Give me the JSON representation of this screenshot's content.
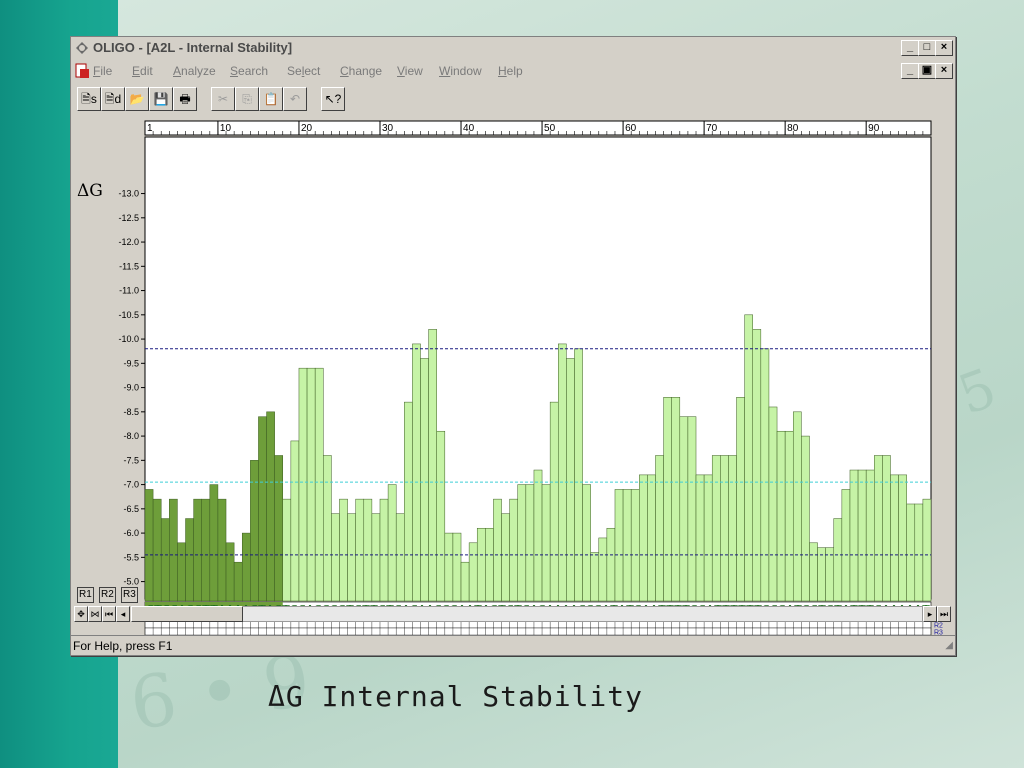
{
  "window": {
    "title": "OLIGO - [A2L - Internal Stability]",
    "controls": {
      "minimize": "_",
      "maximize": "□",
      "close": "×"
    },
    "mdi_controls": {
      "minimize": "_",
      "restore": "▣",
      "close": "×"
    }
  },
  "menu": {
    "items": [
      {
        "key": "F",
        "rest": "ile"
      },
      {
        "key": "E",
        "rest": "dit"
      },
      {
        "key": "A",
        "rest": "nalyze"
      },
      {
        "key": "S",
        "rest": "earch"
      },
      {
        "key": "l",
        "pre": "Se",
        "rest": "ect"
      },
      {
        "key": "C",
        "rest": "hange"
      },
      {
        "key": "V",
        "rest": "iew"
      },
      {
        "key": "W",
        "rest": "indow"
      },
      {
        "key": "H",
        "rest": "elp"
      }
    ]
  },
  "toolbar": {
    "buttons": [
      {
        "icon": "sense-primer-icon",
        "glyph": "🗎s",
        "disabled": false
      },
      {
        "icon": "antisense-primer-icon",
        "glyph": "🗎d",
        "disabled": false
      },
      {
        "icon": "open-folder-icon",
        "glyph": "📂",
        "disabled": false
      },
      {
        "icon": "save-icon",
        "glyph": "💾",
        "disabled": false
      },
      {
        "icon": "print-icon",
        "glyph": "🖶",
        "disabled": false
      },
      {
        "icon": "cut-icon",
        "glyph": "✂",
        "disabled": true
      },
      {
        "icon": "copy-icon",
        "glyph": "⎘",
        "disabled": true
      },
      {
        "icon": "paste-icon",
        "glyph": "📋",
        "disabled": true
      },
      {
        "icon": "undo-icon",
        "glyph": "↶",
        "disabled": true
      },
      {
        "icon": "help-pointer-icon",
        "glyph": "↖?",
        "disabled": false
      }
    ]
  },
  "chart_data": {
    "type": "bar",
    "ylabel": "ΔG",
    "ylim": [
      -4.6,
      -13.3
    ],
    "yticks": [
      "-13.0",
      "-12.5",
      "-12.0",
      "-11.5",
      "-11.0",
      "-10.5",
      "-10.0",
      "-9.5",
      "-9.0",
      "-8.5",
      "-8.0",
      "-7.5",
      "-7.0",
      "-6.5",
      "-6.0",
      "-5.5",
      "-5.0"
    ],
    "xticks": [
      "1",
      "10",
      "20",
      "30",
      "40",
      "50",
      "60",
      "70",
      "80",
      "90"
    ],
    "xtick_positions": [
      1,
      10,
      20,
      30,
      40,
      50,
      60,
      70,
      80,
      90
    ],
    "hlines": [
      {
        "value": -9.8,
        "color": "#1a1a80",
        "style": "dashed"
      },
      {
        "value": -7.05,
        "color": "#3fcfd8",
        "style": "dashed"
      },
      {
        "value": -5.55,
        "color": "#1a1a80",
        "style": "dashed"
      }
    ],
    "highlight_count": 17,
    "colors": {
      "highlight": "#6e9e3a",
      "normal": "#c6f3a6",
      "edge": "#3a5a20"
    },
    "values": [
      -6.9,
      -6.7,
      -6.3,
      -6.7,
      -5.8,
      -6.3,
      -6.7,
      -6.7,
      -7.0,
      -6.7,
      -5.8,
      -5.4,
      -6.0,
      -7.5,
      -8.4,
      -8.5,
      -7.6,
      -6.7,
      -7.9,
      -9.4,
      -9.4,
      -9.4,
      -7.6,
      -6.4,
      -6.7,
      -6.4,
      -6.7,
      -6.7,
      -6.4,
      -6.7,
      -7.0,
      -6.4,
      -8.7,
      -9.9,
      -9.6,
      -10.2,
      -8.1,
      -6.0,
      -6.0,
      -5.4,
      -5.8,
      -6.1,
      -6.1,
      -6.7,
      -6.4,
      -6.7,
      -7.0,
      -7.0,
      -7.3,
      -7.0,
      -8.7,
      -9.9,
      -9.6,
      -9.8,
      -7.0,
      -5.6,
      -5.9,
      -6.1,
      -6.9,
      -6.9,
      -6.9,
      -7.2,
      -7.2,
      -7.6,
      -8.8,
      -8.8,
      -8.4,
      -8.4,
      -7.2,
      -7.2,
      -7.6,
      -7.6,
      -7.6,
      -8.8,
      -10.5,
      -10.2,
      -9.8,
      -8.6,
      -8.1,
      -8.1,
      -8.5,
      -8.0,
      -5.8,
      -5.7,
      -5.7,
      -6.3,
      -6.9,
      -7.3,
      -7.3,
      -7.3,
      -7.6,
      -7.6,
      -7.2,
      -7.2,
      -6.6,
      -6.6,
      -6.7
    ]
  },
  "sequence": {
    "text": "CTCCAGCTTAAAACTACTGCAGGGGTCTTCTCACAACGGAATAGTCTCAGAAAACGGATATGAATTTTGCATTTTTTGCGATGCTGTATTTCAAAAAT",
    "row_labels": [
      "R1",
      "R2",
      "R3"
    ]
  },
  "rtabs": [
    "R1",
    "R2",
    "R3"
  ],
  "status": {
    "text": "For Help, press F1"
  },
  "caption": "ΔG Internal Stability",
  "background_digits": [
    "6 • 9",
    "6·",
    "5",
    ".5"
  ]
}
